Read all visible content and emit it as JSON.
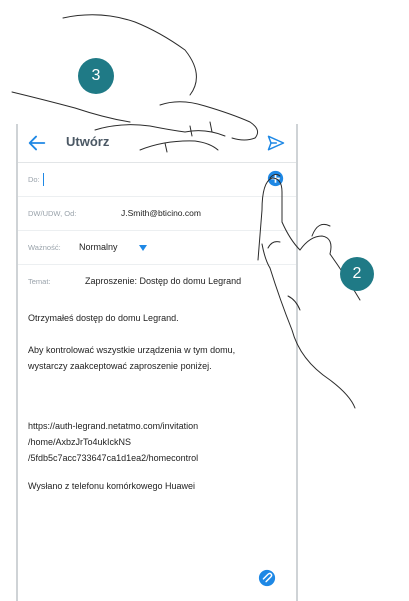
{
  "appbar": {
    "title": "Utwórz"
  },
  "compose": {
    "to_label": "Do:",
    "cc_label": "DW/UDW, Od:",
    "cc_value": "J.Smith@bticino.com",
    "priority_label": "Ważność:",
    "priority_value": "Normalny",
    "subject_label": "Temat:",
    "subject_value": "Zaproszenie: Dostęp do domu Legrand"
  },
  "body": {
    "line1": "Otrzymałeś dostęp do domu Legrand.",
    "line2": "Aby kontrolować wszystkie urządzenia w tym domu, wystarczy zaakceptować zaproszenie poniżej.",
    "link": "https://auth-legrand.netatmo.com/invitation/home/AxbzJrTo4ukIckNS/5fdb5c7acc733647ca1d1ea2/homecontrol",
    "link_l1": "https://auth-legrand.netatmo.com/invitation",
    "link_l2": "/home/AxbzJrTo4ukIckNS",
    "link_l3": "/5fdb5c7acc733647ca1d1ea2/homecontrol",
    "signature": "Wysłano z telefonu komórkowego Huawei"
  },
  "markers": {
    "step3": "3",
    "step2": "2"
  },
  "colors": {
    "accent": "#1e88e5",
    "marker": "#1f7a86"
  },
  "icons": [
    "back-arrow-icon",
    "send-icon",
    "add-contact-icon",
    "dropdown-icon",
    "attachment-icon",
    "hand-icon"
  ]
}
